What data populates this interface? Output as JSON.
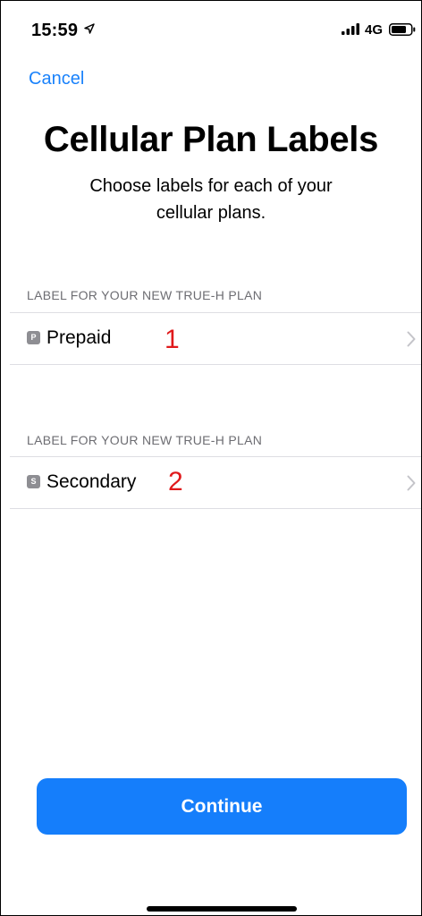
{
  "status_bar": {
    "time": "15:59",
    "network": "4G",
    "icons": [
      "location-arrow-icon",
      "cellular-signal-icon",
      "battery-icon"
    ]
  },
  "nav": {
    "cancel_label": "Cancel"
  },
  "header": {
    "title": "Cellular Plan Labels",
    "subtitle": "Choose labels for each of your cellular plans."
  },
  "plans": [
    {
      "section_header": "LABEL FOR YOUR NEW TRUE-H PLAN",
      "badge": "P",
      "label": "Prepaid",
      "annotation": "1"
    },
    {
      "section_header": "LABEL FOR YOUR NEW TRUE-H PLAN",
      "badge": "S",
      "label": "Secondary",
      "annotation": "2"
    }
  ],
  "footer": {
    "continue_label": "Continue"
  },
  "colors": {
    "accent": "#157efb",
    "link": "#1a82fb",
    "annotation": "#e0191b",
    "badge": "#8e8e93"
  }
}
